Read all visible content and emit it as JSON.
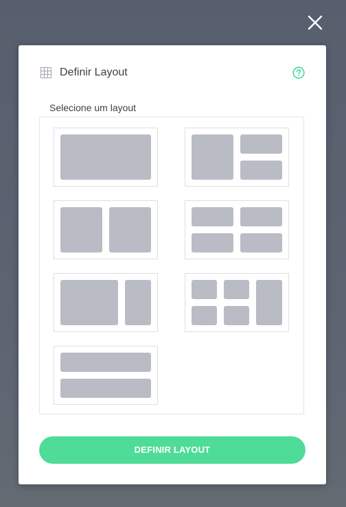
{
  "modal": {
    "title": "Definir Layout",
    "header_icon": "grid-icon",
    "help_icon": "help-circle-icon",
    "close_icon": "close-icon",
    "section_label": "Selecione um layout",
    "submit_label": "DEFINIR LAYOUT"
  },
  "layouts": [
    {
      "id": "single",
      "icon": "layout-single-icon"
    },
    {
      "id": "left-large-right-two-stacked",
      "icon": "layout-left-large-right-stacked-icon"
    },
    {
      "id": "two-columns",
      "icon": "layout-two-columns-icon"
    },
    {
      "id": "two-by-two-grid",
      "icon": "layout-grid-2x2-icon"
    },
    {
      "id": "wide-left-narrow-right",
      "icon": "layout-wide-narrow-icon"
    },
    {
      "id": "four-small-plus-tall-right",
      "icon": "layout-four-plus-tall-icon"
    },
    {
      "id": "two-rows",
      "icon": "layout-two-rows-icon"
    }
  ],
  "colors": {
    "accent": "#4fdc98",
    "help": "#3ddc97",
    "placeholder": "#b9bcc4",
    "backdrop": "#5b6371"
  }
}
